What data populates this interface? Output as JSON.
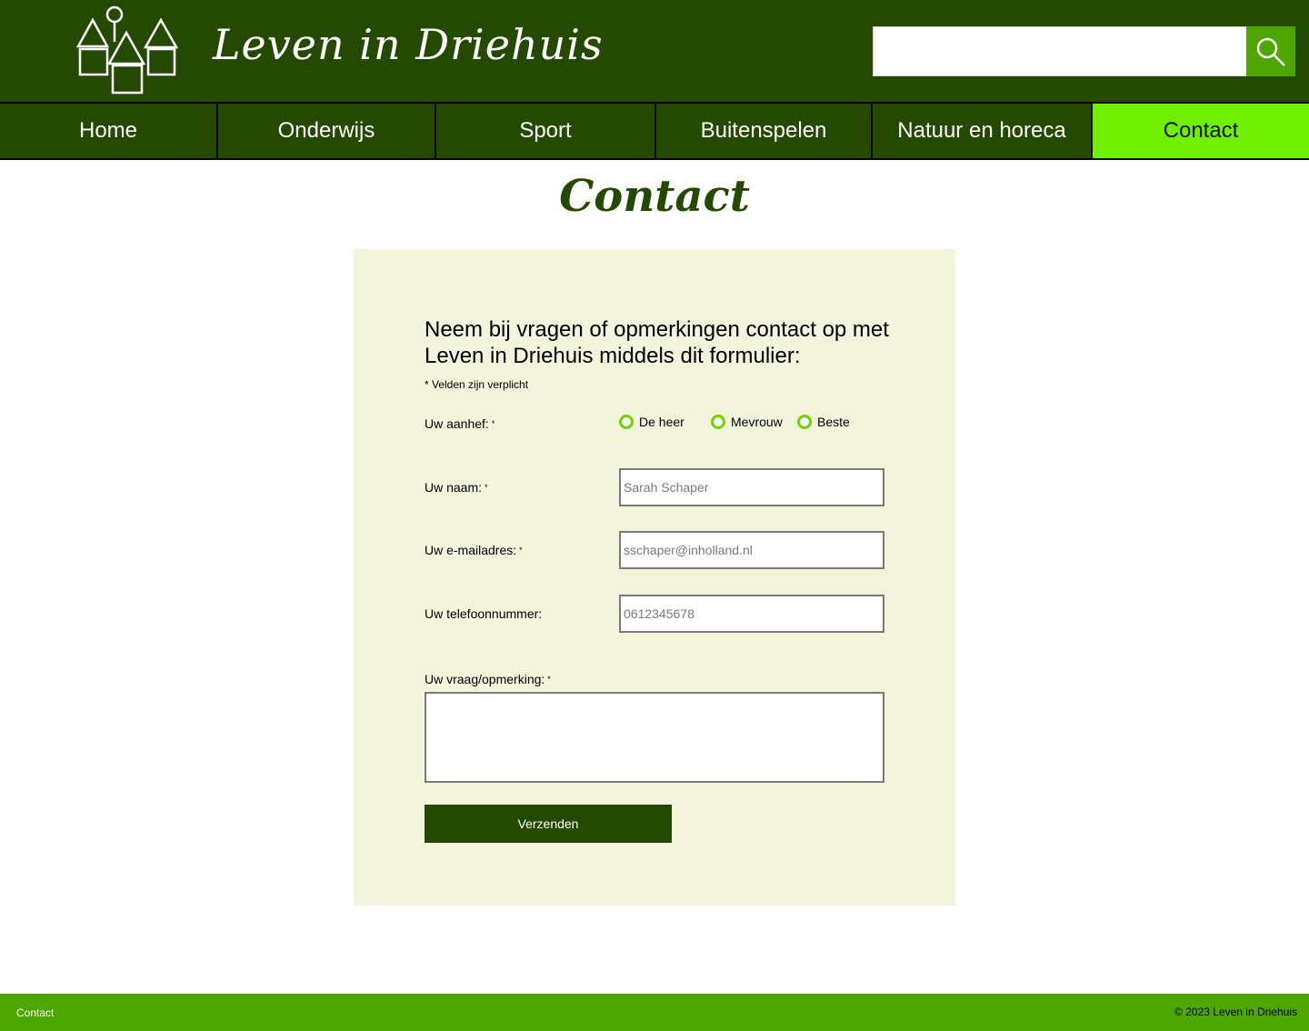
{
  "header": {
    "logo_icon": "houses-logo-icon",
    "site_title": "Leven in Driehuis",
    "search": {
      "value": "",
      "button_icon": "search-icon"
    }
  },
  "nav": {
    "items": [
      {
        "label": "Home"
      },
      {
        "label": "Onderwijs"
      },
      {
        "label": "Sport"
      },
      {
        "label": "Buitenspelen"
      },
      {
        "label": "Natuur en horeca"
      },
      {
        "label": "Contact",
        "active": true
      }
    ]
  },
  "page": {
    "title": "Contact"
  },
  "form": {
    "intro": "Neem bij vragen of opmerkingen contact op met Leven in Driehuis middels dit formulier:",
    "required_note": "* Velden zijn verplicht",
    "required_marker": "*",
    "salutation": {
      "label": "Uw aanhef:",
      "options": [
        "De heer",
        "Mevrouw",
        "Beste"
      ]
    },
    "name": {
      "label": "Uw naam:",
      "placeholder": "Sarah Schaper"
    },
    "email": {
      "label": "Uw e-mailadres:",
      "placeholder": "sschaper@inholland.nl"
    },
    "phone": {
      "label": "Uw telefoonnummer:",
      "placeholder": "0612345678"
    },
    "message": {
      "label": "Uw vraag/opmerking:",
      "value": ""
    },
    "submit_label": "Verzenden"
  },
  "footer": {
    "link": "Contact",
    "copyright": "© 2023 Leven in Driehuis"
  },
  "colors": {
    "header_bg": "#244a02",
    "accent_active": "#6ff000",
    "footer_bg": "#4ea600",
    "panel_bg": "#f3f4dc",
    "radio_ring": "#6fd600"
  }
}
